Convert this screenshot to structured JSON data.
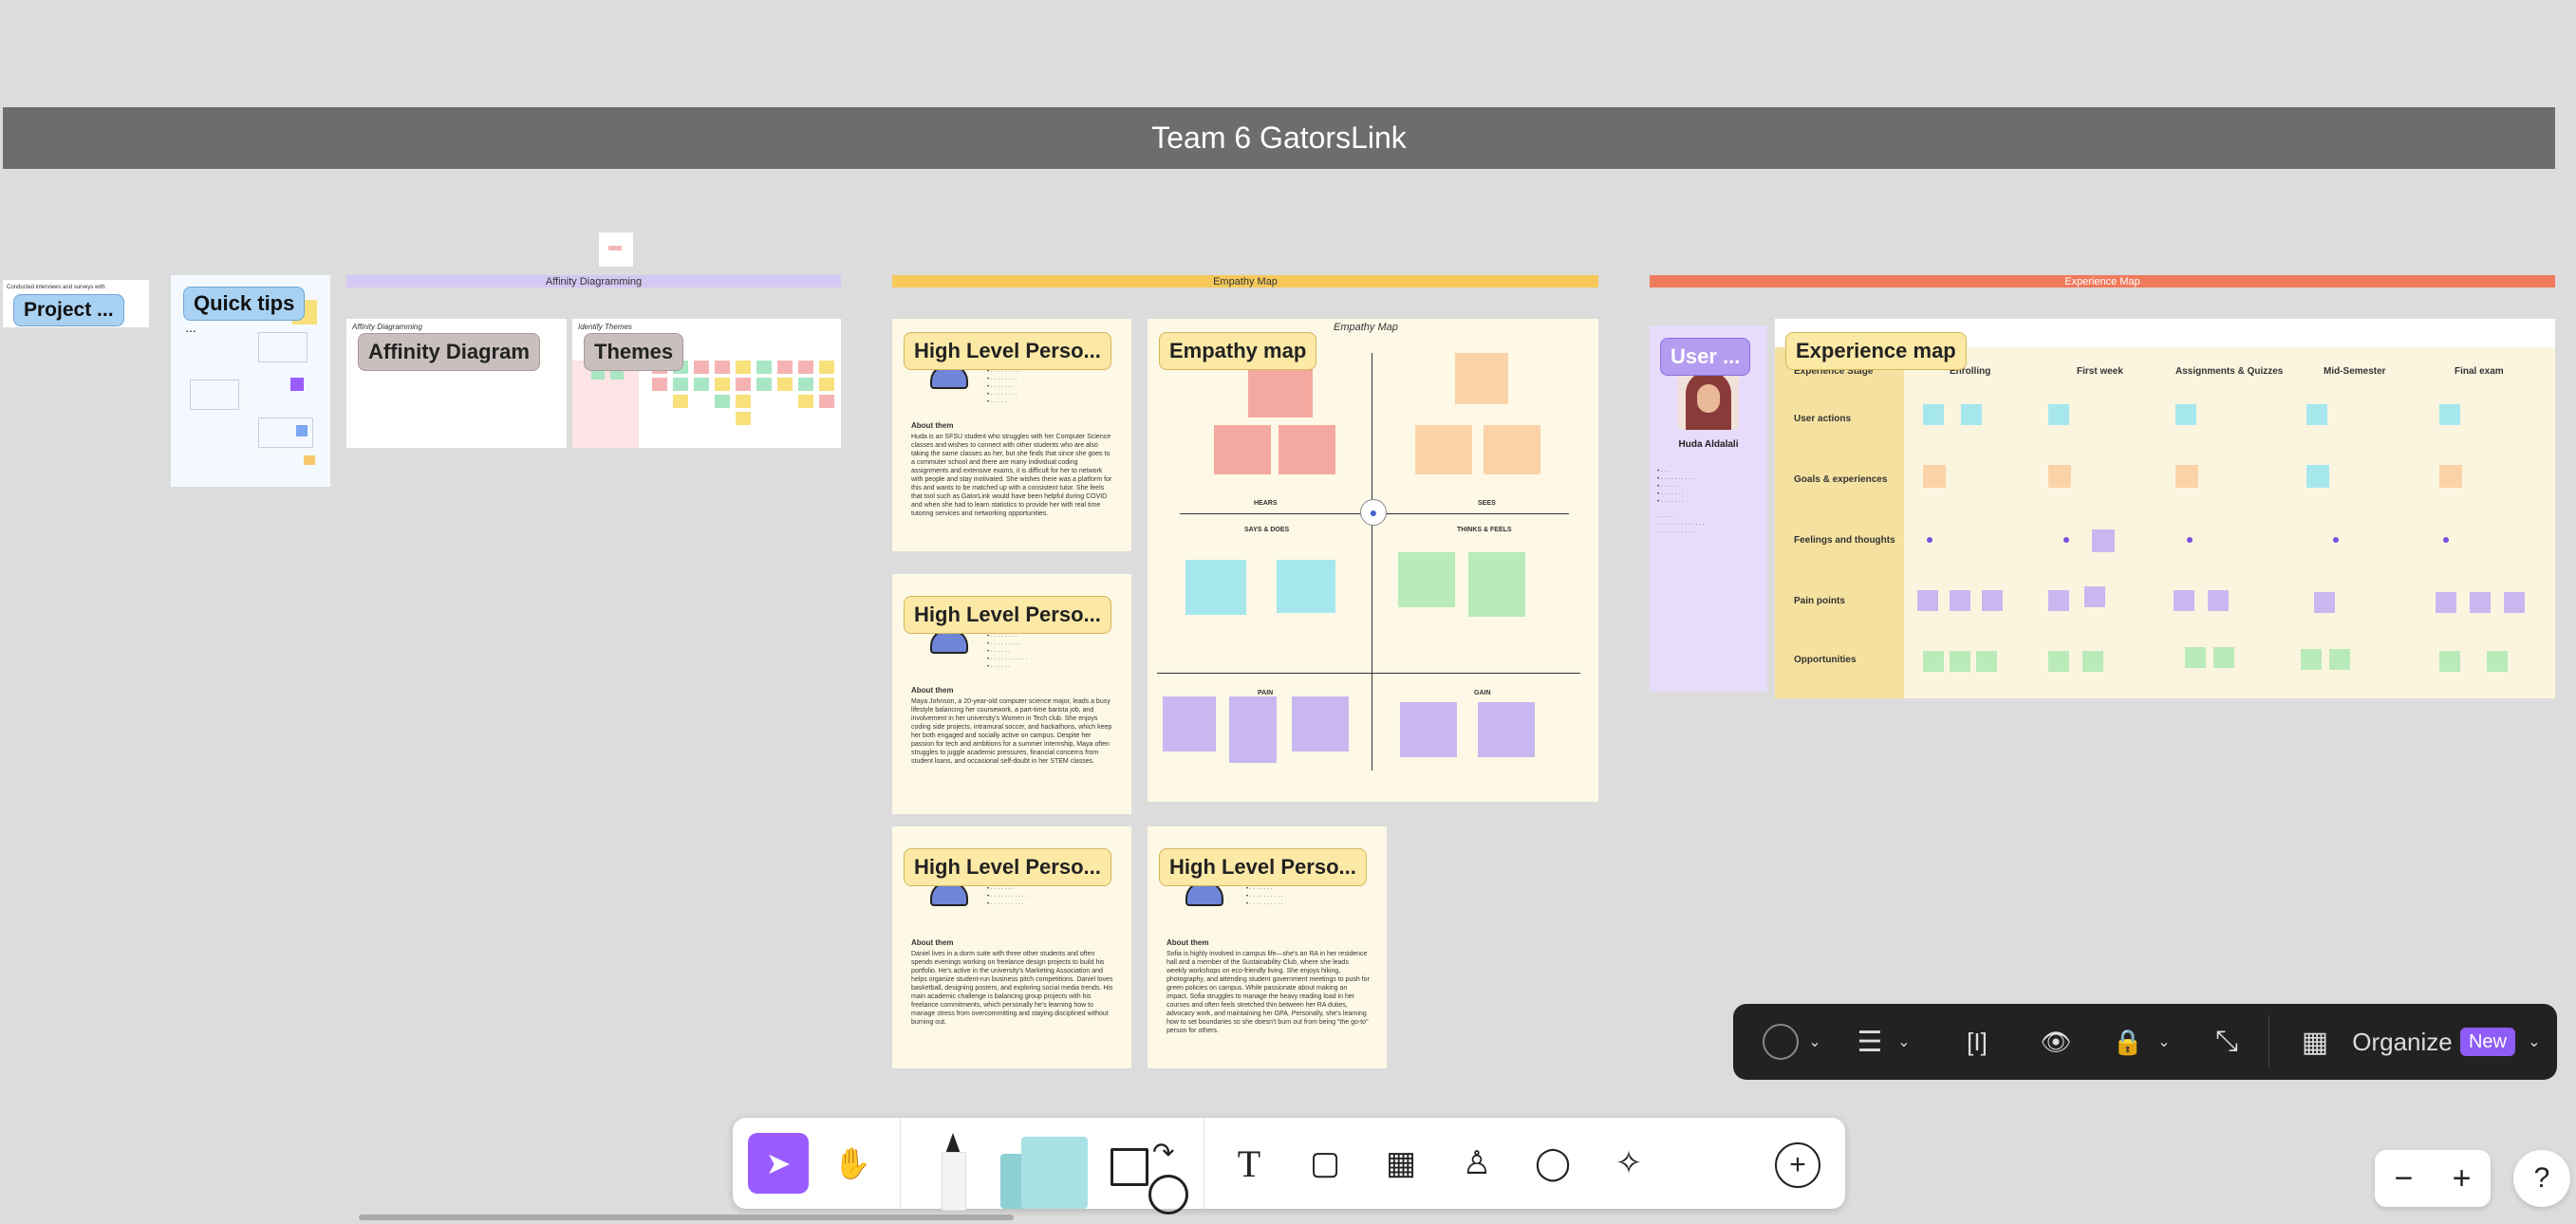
{
  "board": {
    "title": "Team 6 GatorsLink",
    "sections": {
      "affinity": "Affinity Diagramming",
      "empathy": "Empathy Map",
      "experience": "Experience Map"
    }
  },
  "frames": {
    "project": {
      "tag": "Project ...",
      "snippet": "Conducted interviews and surveys with"
    },
    "quick_tips": {
      "tag": "Quick tips"
    },
    "affinity_diagram": {
      "tag": "Affinity Diagram",
      "header": "Affinity Diagramming"
    },
    "themes": {
      "tag": "Themes",
      "header": "Identify Themes"
    },
    "persona1": {
      "tag": "High Level Perso...",
      "about_label": "About them",
      "about": "Huda is an SFSU student who struggles with her Computer Science classes and wishes to connect with other students who are also taking the same classes as her, but she finds that since she goes to a commuter school and there are many individual coding assignments and extensive exams, it is difficult for her to network with people and stay motivated. She wishes there was a platform for this and wants to be matched up with a consistent tutor. She feels that tool such as GatorLink would have been helpful during COVID and when she had to learn statistics to provide her with real time tutoring services and networking opportunities."
    },
    "persona2": {
      "tag": "High Level Perso...",
      "about_label": "About them",
      "about": "Maya Johnson, a 20-year-old computer science major, leads a busy lifestyle balancing her coursework, a part-time barista job, and involvement in her university's Women in Tech club. She enjoys coding side projects, intramural soccer, and hackathons, which keep her both engaged and socially active on campus. Despite her passion for tech and ambitions for a summer internship, Maya often struggles to juggle academic pressures, financial concerns from student loans, and occasional self-doubt in her STEM classes."
    },
    "persona3": {
      "tag": "High Level Perso...",
      "about_label": "About them",
      "about": "Daniel lives in a dorm suite with three other students and often spends evenings working on freelance design projects to build his portfolio. He's active in the university's Marketing Association and helps organize student-run business pitch competitions. Daniel loves basketball, designing posters, and exploring social media trends. His main academic challenge is balancing group projects with his freelance commitments, which personally he's learning how to manage stress from overcommitting and staying disciplined without burning out."
    },
    "persona4": {
      "tag": "High Level Perso...",
      "about_label": "About them",
      "about": "Sofia is highly involved in campus life—she's an RA in her residence hall and a member of the Sustainability Club, where she leads weekly workshops on eco-friendly living. She enjoys hiking, photography, and attending student government meetings to push for green policies on campus. While passionate about making an impact, Sofia struggles to manage the heavy reading load in her courses and often feels stretched thin between her RA duties, advocacy work, and maintaining her GPA. Personally, she's learning how to set boundaries so she doesn't burn out from being \"the go-to\" person for others."
    },
    "empathy_map": {
      "tag": "Empathy map",
      "header": "Empathy Map",
      "hears": "HEARS",
      "sees": "SEES",
      "says_does": "SAYS & DOES",
      "thinks_feels": "THINKS & FEELS",
      "pain": "PAIN",
      "gain": "GAIN"
    },
    "user": {
      "tag": "User ...",
      "name": "Huda Aldalali"
    },
    "experience_map": {
      "tag": "Experience map",
      "columns": [
        "Experience Stage",
        "Enrolling",
        "First week",
        "Assignments & Quizzes",
        "Mid-Semester",
        "Final exam"
      ],
      "rows": [
        "User actions",
        "Goals & experiences",
        "Feelings and thoughts",
        "Pain points",
        "Opportunities"
      ]
    }
  },
  "toolbar": {
    "tools": [
      "select-tool",
      "hand-tool",
      "pen-tool",
      "sticky-note-tool",
      "shape-tool",
      "text-tool",
      "frame-tool",
      "table-tool",
      "stamp-tool",
      "comment-tool",
      "ai-tool",
      "more-tool"
    ]
  },
  "context_bar": {
    "organize_label": "Organize",
    "new_badge": "New"
  },
  "zoom": {
    "minus": "−",
    "plus": "+",
    "help": "?"
  },
  "colors": {
    "title_bar": "#6d6d6d",
    "affinity_bar": "#d4c9f4",
    "empathy_bar": "#f6c95a",
    "experience_bar": "#ef7a5c",
    "accent": "#9b5cff"
  }
}
